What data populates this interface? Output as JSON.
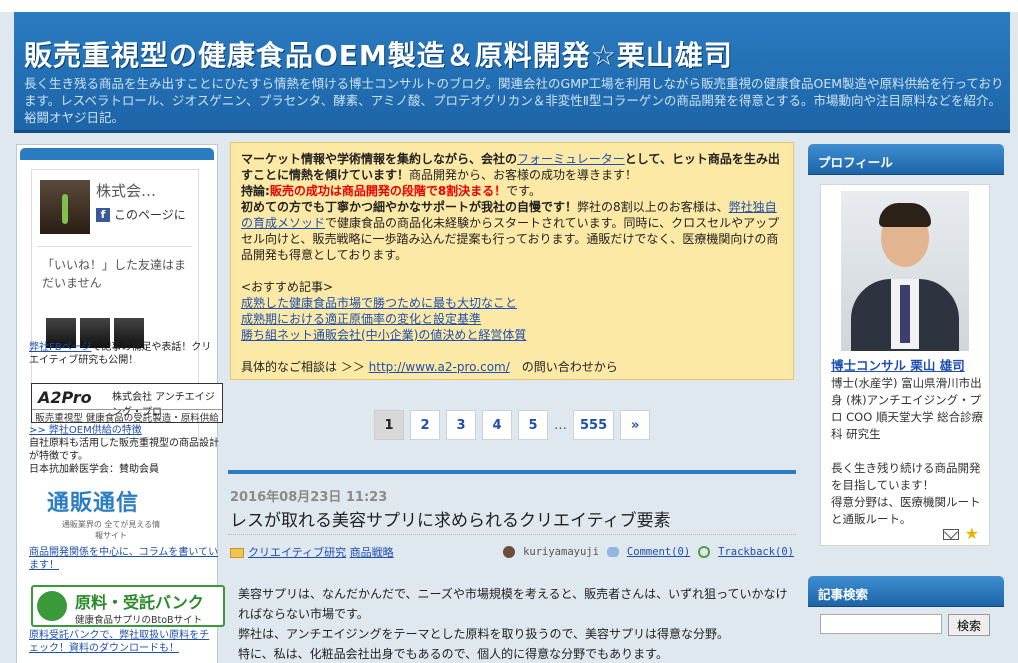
{
  "header": {
    "title": "販売重視型の健康食品OEM製造＆原料開発☆栗山雄司",
    "description": "長く生き残る商品を生み出すことにひたすら情熱を傾ける博士コンサルトのブログ。関連会社のGMP工場を利用しながら販売重視の健康食品OEM製造や原料供給を行っております。レスベラトロール、ジオスゲニン、プラセンタ、酵素、アミノ酸、プロテオグリカン＆非変性Ⅱ型コラーゲンの商品開発を得意とする。市場動向や注目原料などを紹介。裕闘オヤジ日記。"
  },
  "left_sidebar": {
    "fb_page_name": "株式会…",
    "fb_like_label": "このページに",
    "fb_friends_text": "「いいね！」した友達はまだいません",
    "fb_link": "弊社FBページ",
    "fb_link_text": "で記事の補足や表話！クリエイティブ研究も公開！",
    "a2_logo_main": "A2Pro",
    "a2_logo_company": "株式会社 アンチエイジング・プロ",
    "a2_logo_caption": "販売重視型 健康食品の受託製造・原料供給",
    "oem_link": ">> 弊社OEM供給の特徴",
    "oem_text": "自社原料も活用した販売重視型の商品設計が特徴です。",
    "member_text": "日本抗加齢医学会：賛助会員",
    "tsuhan_title": "通販通信",
    "tsuhan_sub": "通販業界の 全てが見える情報サイト",
    "tsuhan_link": "商品開発関係を中心に、コラムを書いています！",
    "genryo_title": "原料・受託バンク",
    "genryo_sub": "健康食品サプリのBtoBサイト",
    "genryo_link": "原料受託バンクで、弊社取扱い原料をチェック！資料のダウンロードも！"
  },
  "notice": {
    "line1a": "マーケット情報や学術情報を集約しながら、会社の",
    "line1_link": "フォーミュレーター",
    "line1b": "として、ヒット商品を生み出すことに情熱を傾けています！",
    "line1c": "商品開発から、お客様の成功を導きます！",
    "motto_label": "持論:",
    "motto_text": "販売の成功は商品開発の段階で8割決まる！",
    "motto_end": "です。",
    "line3a": "初めての方でも丁寧かつ細やかなサポートが我社の自慢です！",
    "line3b": "弊社の8割以上のお客様は、",
    "line3_link": "弊社独自の育成メソッド",
    "line3c": "で健康食品の商品化未経験からスタートされています。同時に、クロスセルやアップセル向けと、販売戦略に一歩踏み込んだ提案も行っております。通販だけでなく、医療機関向けの商品開発も得意としております。",
    "rec_label": "<おすすめ記事>",
    "rec_links": [
      "成熟した健康食品市場で勝つために最も大切なこと",
      "成熟期における適正原価率の変化と設定基準",
      "勝ち組ネット通販会社(中小企業)の値決めと経営体質"
    ],
    "contact_a": "具体的なご相談は ＞＞ ",
    "contact_link": "http://www.a2-pro.com/",
    "contact_b": "　の問い合わせから"
  },
  "pager": {
    "pages": [
      "1",
      "2",
      "3",
      "4",
      "5"
    ],
    "dots": "…",
    "last": "555",
    "next": "»",
    "current": "1"
  },
  "post": {
    "date": "2016年08月23日 11:23",
    "title": "レスが取れる美容サプリに求められるクリエイティブ要素",
    "categories": [
      "クリエイティブ研究",
      "商品戦略"
    ],
    "author": "kuriyamayuji",
    "comment": "Comment(0)",
    "trackback": "Trackback(0)",
    "body": [
      "美容サプリは、なんだかんだで、ニーズや市場規模を考えると、販売者さんは、いずれ狙っていかなければならない市場です。",
      "弊社は、アンチエイジングをテーマとした原料を取り扱うので、美容サプリは得意な分野。",
      "特に、私は、化粧品会社出身でもあるので、個人的に得意な分野でもあります。"
    ]
  },
  "profile": {
    "heading": "プロフィール",
    "name": "博士コンサル 栗山 雄司",
    "bio": "博士(水産学) 富山県滑川市出身 (株)アンチエイジング・プロ COO 順天堂大学 総合診療科 研究生",
    "message": "長く生き残り続ける商品開発を目指しています！",
    "specialty": "得意分野は、医療機関ルートと通販ルート。"
  },
  "search": {
    "heading": "記事検索",
    "button": "検索",
    "placeholder": ""
  },
  "colors": {
    "header_bg": "#1f6fb4",
    "notice_bg": "#fce9a6",
    "link": "#1f4fb0",
    "accent_red": "#e00000"
  }
}
